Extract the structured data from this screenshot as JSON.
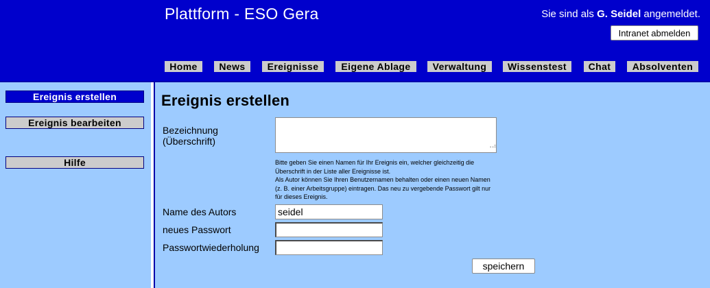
{
  "header": {
    "site_title": "Plattform - ESO Gera",
    "login_prefix": "Sie sind als ",
    "user_name": "G. Seidel",
    "login_suffix": " angemeldet.",
    "logout_label": "Intranet abmelden"
  },
  "nav": {
    "items": [
      {
        "label": "Home"
      },
      {
        "label": "News"
      },
      {
        "label": "Ereignisse"
      },
      {
        "label": "Eigene Ablage"
      },
      {
        "label": "Verwaltung"
      },
      {
        "label": "Wissenstest"
      },
      {
        "label": "Chat"
      },
      {
        "label": "Absolventen"
      }
    ]
  },
  "sidebar": {
    "items": [
      {
        "label": "Ereignis erstellen",
        "active": true
      },
      {
        "label": "Ereignis bearbeiten",
        "active": false
      },
      {
        "label": "Hilfe",
        "active": false
      }
    ]
  },
  "main": {
    "page_title": "Ereignis erstellen",
    "form": {
      "title_label_line1": "Bezeichnung",
      "title_label_line2": "(Überschrift)",
      "title_value": "",
      "help_line1": "Bitte geben Sie einen Namen für Ihr Ereignis ein, welcher gleichzeitig die",
      "help_line2": "Überschrift in der Liste aller Ereignisse ist.",
      "help_line3": "Als Autor können Sie Ihren Benutzernamen behalten oder einen neuen Namen",
      "help_line4": "(z. B. einer Arbeitsgruppe) eintragen. Das neu zu vergebende Passwort gilt nur",
      "help_line5": "für dieses Ereignis.",
      "author_label": "Name des Autors",
      "author_value": "seidel",
      "password_label": "neues Passwort",
      "password_value": "",
      "password_repeat_label": "Passwortwiederholung",
      "password_repeat_value": "",
      "save_label": "speichern"
    }
  },
  "colors": {
    "header_bg": "#0000cc",
    "page_bg": "#9dcbff",
    "nav_button_bg": "#cccccc",
    "sidebar_active_bg": "#0000cc"
  }
}
